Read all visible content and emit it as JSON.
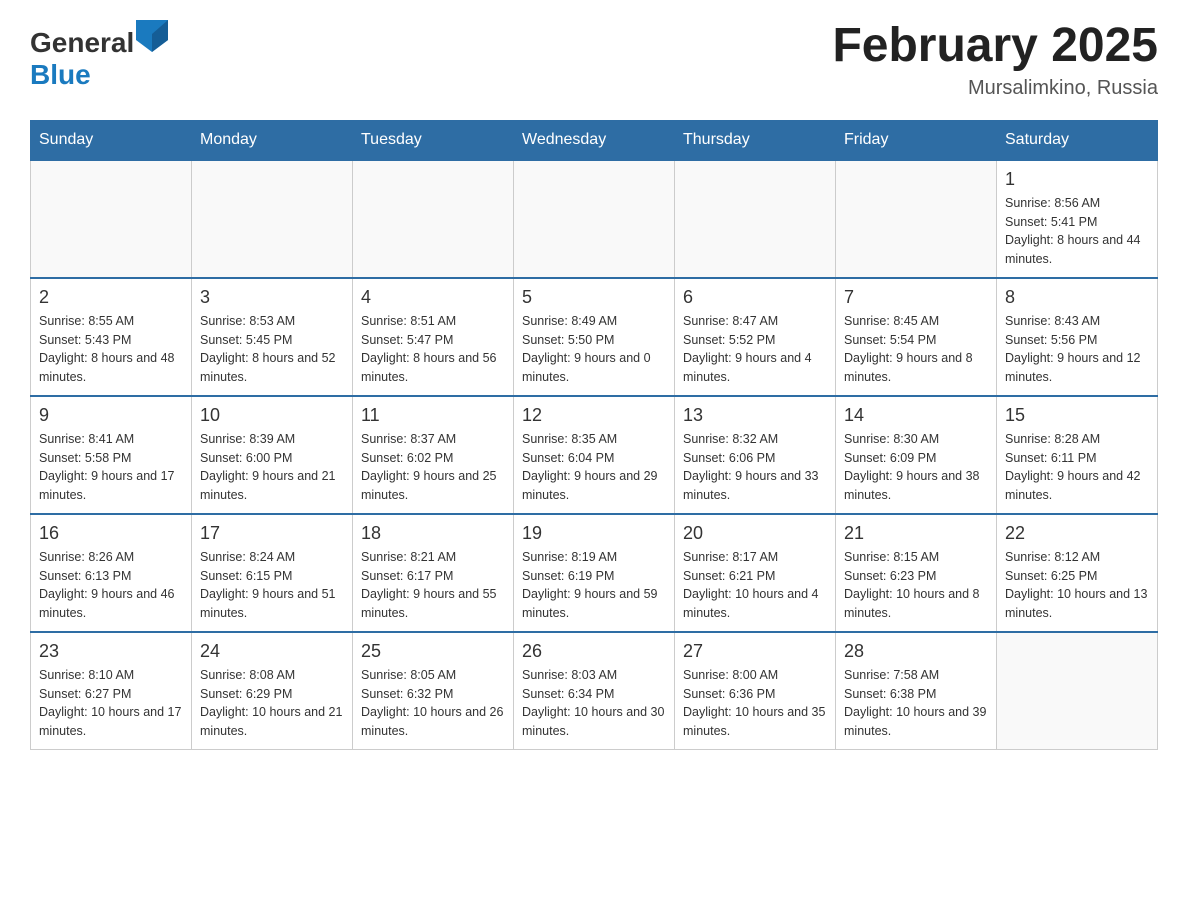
{
  "header": {
    "logo": {
      "text_general": "General",
      "text_blue": "Blue",
      "tagline": ""
    },
    "title": "February 2025",
    "location": "Mursalimkino, Russia"
  },
  "weekdays": [
    "Sunday",
    "Monday",
    "Tuesday",
    "Wednesday",
    "Thursday",
    "Friday",
    "Saturday"
  ],
  "weeks": [
    [
      {
        "day": "",
        "info": ""
      },
      {
        "day": "",
        "info": ""
      },
      {
        "day": "",
        "info": ""
      },
      {
        "day": "",
        "info": ""
      },
      {
        "day": "",
        "info": ""
      },
      {
        "day": "",
        "info": ""
      },
      {
        "day": "1",
        "info": "Sunrise: 8:56 AM\nSunset: 5:41 PM\nDaylight: 8 hours and 44 minutes."
      }
    ],
    [
      {
        "day": "2",
        "info": "Sunrise: 8:55 AM\nSunset: 5:43 PM\nDaylight: 8 hours and 48 minutes."
      },
      {
        "day": "3",
        "info": "Sunrise: 8:53 AM\nSunset: 5:45 PM\nDaylight: 8 hours and 52 minutes."
      },
      {
        "day": "4",
        "info": "Sunrise: 8:51 AM\nSunset: 5:47 PM\nDaylight: 8 hours and 56 minutes."
      },
      {
        "day": "5",
        "info": "Sunrise: 8:49 AM\nSunset: 5:50 PM\nDaylight: 9 hours and 0 minutes."
      },
      {
        "day": "6",
        "info": "Sunrise: 8:47 AM\nSunset: 5:52 PM\nDaylight: 9 hours and 4 minutes."
      },
      {
        "day": "7",
        "info": "Sunrise: 8:45 AM\nSunset: 5:54 PM\nDaylight: 9 hours and 8 minutes."
      },
      {
        "day": "8",
        "info": "Sunrise: 8:43 AM\nSunset: 5:56 PM\nDaylight: 9 hours and 12 minutes."
      }
    ],
    [
      {
        "day": "9",
        "info": "Sunrise: 8:41 AM\nSunset: 5:58 PM\nDaylight: 9 hours and 17 minutes."
      },
      {
        "day": "10",
        "info": "Sunrise: 8:39 AM\nSunset: 6:00 PM\nDaylight: 9 hours and 21 minutes."
      },
      {
        "day": "11",
        "info": "Sunrise: 8:37 AM\nSunset: 6:02 PM\nDaylight: 9 hours and 25 minutes."
      },
      {
        "day": "12",
        "info": "Sunrise: 8:35 AM\nSunset: 6:04 PM\nDaylight: 9 hours and 29 minutes."
      },
      {
        "day": "13",
        "info": "Sunrise: 8:32 AM\nSunset: 6:06 PM\nDaylight: 9 hours and 33 minutes."
      },
      {
        "day": "14",
        "info": "Sunrise: 8:30 AM\nSunset: 6:09 PM\nDaylight: 9 hours and 38 minutes."
      },
      {
        "day": "15",
        "info": "Sunrise: 8:28 AM\nSunset: 6:11 PM\nDaylight: 9 hours and 42 minutes."
      }
    ],
    [
      {
        "day": "16",
        "info": "Sunrise: 8:26 AM\nSunset: 6:13 PM\nDaylight: 9 hours and 46 minutes."
      },
      {
        "day": "17",
        "info": "Sunrise: 8:24 AM\nSunset: 6:15 PM\nDaylight: 9 hours and 51 minutes."
      },
      {
        "day": "18",
        "info": "Sunrise: 8:21 AM\nSunset: 6:17 PM\nDaylight: 9 hours and 55 minutes."
      },
      {
        "day": "19",
        "info": "Sunrise: 8:19 AM\nSunset: 6:19 PM\nDaylight: 9 hours and 59 minutes."
      },
      {
        "day": "20",
        "info": "Sunrise: 8:17 AM\nSunset: 6:21 PM\nDaylight: 10 hours and 4 minutes."
      },
      {
        "day": "21",
        "info": "Sunrise: 8:15 AM\nSunset: 6:23 PM\nDaylight: 10 hours and 8 minutes."
      },
      {
        "day": "22",
        "info": "Sunrise: 8:12 AM\nSunset: 6:25 PM\nDaylight: 10 hours and 13 minutes."
      }
    ],
    [
      {
        "day": "23",
        "info": "Sunrise: 8:10 AM\nSunset: 6:27 PM\nDaylight: 10 hours and 17 minutes."
      },
      {
        "day": "24",
        "info": "Sunrise: 8:08 AM\nSunset: 6:29 PM\nDaylight: 10 hours and 21 minutes."
      },
      {
        "day": "25",
        "info": "Sunrise: 8:05 AM\nSunset: 6:32 PM\nDaylight: 10 hours and 26 minutes."
      },
      {
        "day": "26",
        "info": "Sunrise: 8:03 AM\nSunset: 6:34 PM\nDaylight: 10 hours and 30 minutes."
      },
      {
        "day": "27",
        "info": "Sunrise: 8:00 AM\nSunset: 6:36 PM\nDaylight: 10 hours and 35 minutes."
      },
      {
        "day": "28",
        "info": "Sunrise: 7:58 AM\nSunset: 6:38 PM\nDaylight: 10 hours and 39 minutes."
      },
      {
        "day": "",
        "info": ""
      }
    ]
  ]
}
